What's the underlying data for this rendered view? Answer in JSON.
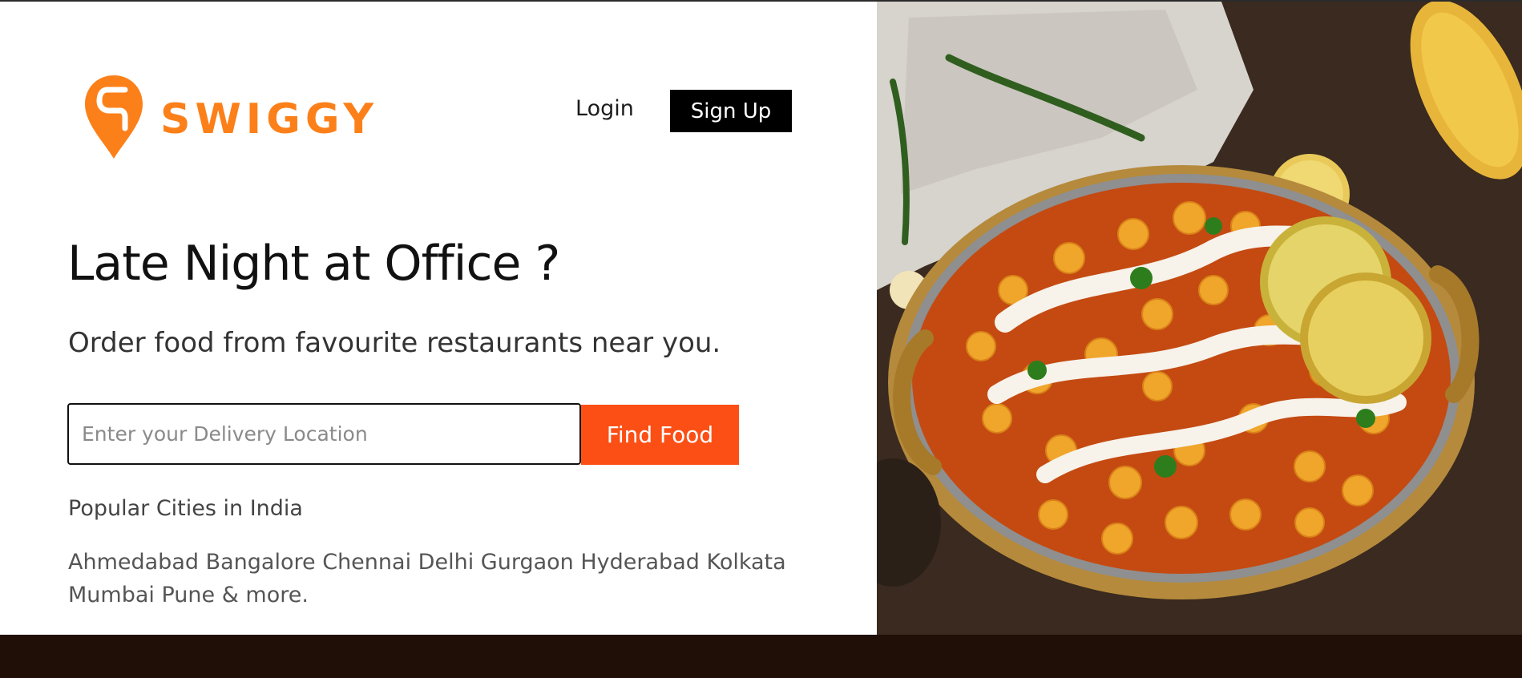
{
  "brand": {
    "name": "SWIGGY",
    "logo_icon": "swiggy-pin-logo",
    "accent_color": "#fc8019"
  },
  "nav": {
    "login_label": "Login",
    "signup_label": "Sign Up"
  },
  "hero": {
    "headline": "Late Night at Office ?",
    "subheadline": "Order food from favourite restaurants near you."
  },
  "search": {
    "placeholder": "Enter your Delivery Location",
    "value": "",
    "button_label": "Find Food",
    "button_color": "#fc4f15"
  },
  "cities": {
    "title": "Popular Cities in India",
    "list": [
      "Ahmedabad",
      "Bangalore",
      "Chennai",
      "Delhi",
      "Gurgaon",
      "Hyderabad",
      "Kolkata",
      "Mumbai",
      "Pune"
    ],
    "more_label": "& more."
  },
  "colors": {
    "footer_band": "#1f0f07",
    "signup_bg": "#000000"
  }
}
